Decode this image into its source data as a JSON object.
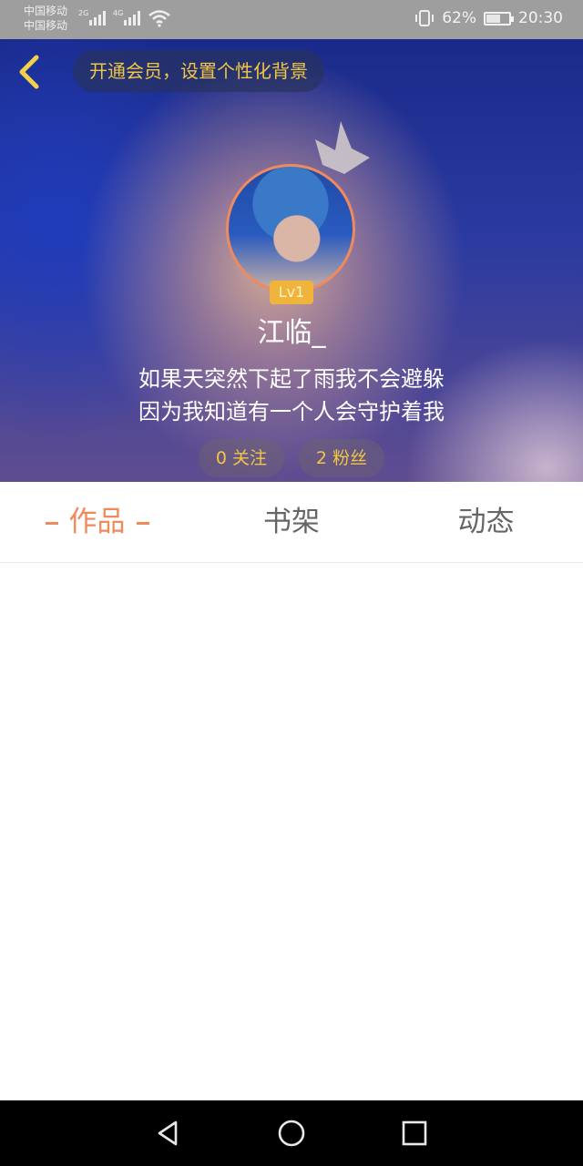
{
  "status_bar": {
    "carrier_1": "中国移动",
    "carrier_2": "中国移动",
    "net_1": "2G",
    "net_2": "4G",
    "battery_percent": "62%",
    "battery_level": 0.62,
    "time": "20:30",
    "icons": [
      "signal-icon",
      "signal-icon",
      "wifi-icon",
      "vibrate-icon",
      "battery-icon"
    ]
  },
  "header": {
    "vip_text": "开通会员，设置个性化背景"
  },
  "profile": {
    "level": "Lv1",
    "username": "江临_",
    "bio_line1": "如果天突然下起了雨我不会避躲",
    "bio_line2": "因为我知道有一个人会守护着我",
    "following": "0 关注",
    "fans": "2 粉丝"
  },
  "tabs": [
    {
      "label": "作品",
      "active": true
    },
    {
      "label": "书架",
      "active": false
    },
    {
      "label": "动态",
      "active": false
    }
  ],
  "colors": {
    "accent": "#ef8a5b",
    "gold": "#f2c643"
  }
}
